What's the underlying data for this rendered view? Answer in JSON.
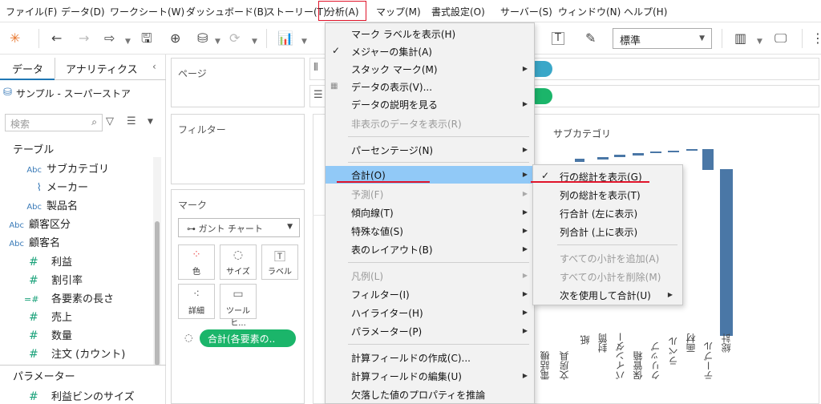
{
  "menubar": {
    "items": [
      "ファイル(F)",
      "データ(D)",
      "ワークシート(W)",
      "ダッシュボード(B)",
      "ストーリー(T)",
      "分析(A)",
      "マップ(M)",
      "書式設定(O)",
      "サーバー(S)",
      "ウィンドウ(N)",
      "ヘルプ(H)"
    ],
    "active": "分析(A)"
  },
  "toolbar": {
    "standard_select": "標準"
  },
  "data_pane": {
    "tabs": [
      "データ",
      "アナリティクス"
    ],
    "active_tab": "データ",
    "source": "サンプル - スーパーストア",
    "search_placeholder": "検索",
    "table_section": "テーブル",
    "fields": [
      {
        "type": "Abc",
        "name": "サブカテゴリ",
        "role": "dimension"
      },
      {
        "type": "paperclip",
        "name": "メーカー",
        "role": "dimension"
      },
      {
        "type": "Abc",
        "name": "製品名",
        "role": "dimension"
      },
      {
        "type": "Abc",
        "name": "顧客区分",
        "role": "dimension"
      },
      {
        "type": "Abc",
        "name": "顧客名",
        "role": "dimension"
      },
      {
        "type": "#",
        "name": "利益",
        "role": "measure"
      },
      {
        "type": "#",
        "name": "割引率",
        "role": "measure"
      },
      {
        "type": "=#",
        "name": "各要素の長さ",
        "role": "measure"
      },
      {
        "type": "#",
        "name": "売上",
        "role": "measure"
      },
      {
        "type": "#",
        "name": "数量",
        "role": "measure"
      },
      {
        "type": "#",
        "name": "注文 (カウント)",
        "role": "measure"
      }
    ],
    "param_section": "パラメーター",
    "params": [
      {
        "type": "#",
        "name": "利益ビンのサイズ"
      }
    ]
  },
  "shelves": {
    "pages": "ページ",
    "filters": "フィルター",
    "marks": "マーク",
    "mark_type": "ガント チャート",
    "mark_buttons": [
      "色",
      "サイズ",
      "ラベル",
      "詳細",
      "ツールヒ..."
    ],
    "mark_pill": "合計(各要素の.."
  },
  "viz": {
    "header_title": "サブカテゴリ",
    "categories": [
      "電話機",
      "文房具",
      "紙",
      "封筒",
      "バインダー",
      "保管箱",
      "クリップ",
      "ラベル",
      "画材",
      "テーブル",
      "総計"
    ],
    "bar_color": "#4a77a6"
  },
  "analysis_menu": {
    "items": [
      {
        "label": "マーク ラベルを表示(H)",
        "checked": false,
        "disabled": false,
        "submenu": false
      },
      {
        "label": "メジャーの集計(A)",
        "checked": true,
        "disabled": false,
        "submenu": false
      },
      {
        "label": "スタック マーク(M)",
        "checked": false,
        "disabled": false,
        "submenu": true
      },
      {
        "label": "データの表示(V)...",
        "checked": false,
        "disabled": false,
        "submenu": false
      },
      {
        "label": "データの説明を見る",
        "checked": false,
        "disabled": false,
        "submenu": true
      },
      {
        "label": "非表示のデータを表示(R)",
        "checked": false,
        "disabled": true,
        "submenu": false
      },
      {
        "label": "パーセンテージ(N)",
        "checked": false,
        "disabled": false,
        "submenu": true
      },
      {
        "label": "合計(O)",
        "checked": false,
        "disabled": false,
        "submenu": true,
        "highlighted": true
      },
      {
        "label": "予測(F)",
        "checked": false,
        "disabled": true,
        "submenu": true
      },
      {
        "label": "傾向線(T)",
        "checked": false,
        "disabled": false,
        "submenu": true
      },
      {
        "label": "特殊な値(S)",
        "checked": false,
        "disabled": false,
        "submenu": true
      },
      {
        "label": "表のレイアウト(B)",
        "checked": false,
        "disabled": false,
        "submenu": true
      },
      {
        "label": "凡例(L)",
        "checked": false,
        "disabled": true,
        "submenu": true
      },
      {
        "label": "フィルター(I)",
        "checked": false,
        "disabled": false,
        "submenu": true
      },
      {
        "label": "ハイライター(H)",
        "checked": false,
        "disabled": false,
        "submenu": true
      },
      {
        "label": "パラメーター(P)",
        "checked": false,
        "disabled": false,
        "submenu": true
      },
      {
        "label": "計算フィールドの作成(C)...",
        "checked": false,
        "disabled": false,
        "submenu": false
      },
      {
        "label": "計算フィールドの編集(U)",
        "checked": false,
        "disabled": false,
        "submenu": true
      },
      {
        "label": "欠落した値のプロパティを推論",
        "checked": false,
        "disabled": false,
        "submenu": false
      }
    ]
  },
  "totals_submenu": {
    "items": [
      {
        "label": "行の総計を表示(G)",
        "checked": true,
        "disabled": false,
        "submenu": false
      },
      {
        "label": "列の総計を表示(T)",
        "checked": false,
        "disabled": false,
        "submenu": false
      },
      {
        "label": "行合計 (左に表示)",
        "checked": false,
        "disabled": false,
        "submenu": false
      },
      {
        "label": "列合計 (上に表示)",
        "checked": false,
        "disabled": false,
        "submenu": false
      },
      {
        "label": "すべての小計を追加(A)",
        "checked": false,
        "disabled": true,
        "submenu": false
      },
      {
        "label": "すべての小計を削除(M)",
        "checked": false,
        "disabled": true,
        "submenu": false
      },
      {
        "label": "次を使用して合計(U)",
        "checked": false,
        "disabled": false,
        "submenu": true
      }
    ]
  },
  "annotation_color": "#e0142a"
}
